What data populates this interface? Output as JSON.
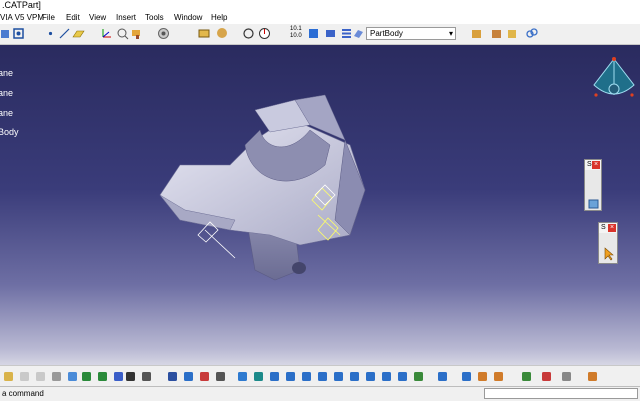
{
  "window": {
    "title": ".CATPart]"
  },
  "menu": [
    {
      "name": "logo",
      "label": "VIA V5 VPM"
    },
    {
      "name": "file",
      "label": "File"
    },
    {
      "name": "edit",
      "label": "Edit"
    },
    {
      "name": "view",
      "label": "View"
    },
    {
      "name": "insert",
      "label": "Insert"
    },
    {
      "name": "tools",
      "label": "Tools"
    },
    {
      "name": "window",
      "label": "Window"
    },
    {
      "name": "help",
      "label": "Help"
    }
  ],
  "toolbar": {
    "body_select": "PartBody",
    "scale_label_top": "10.1",
    "scale_label_bottom": "10.0"
  },
  "tree": {
    "items": [
      "ane",
      "ane",
      "ane",
      "Body"
    ]
  },
  "floating_toolbars": [
    {
      "header": "S"
    },
    {
      "header": "S"
    }
  ],
  "status": {
    "message": "a command"
  },
  "colors": {
    "viewport_top": "#2a2b5f",
    "viewport_bottom": "#d6d6e4",
    "part_face": "#c4c5da"
  }
}
